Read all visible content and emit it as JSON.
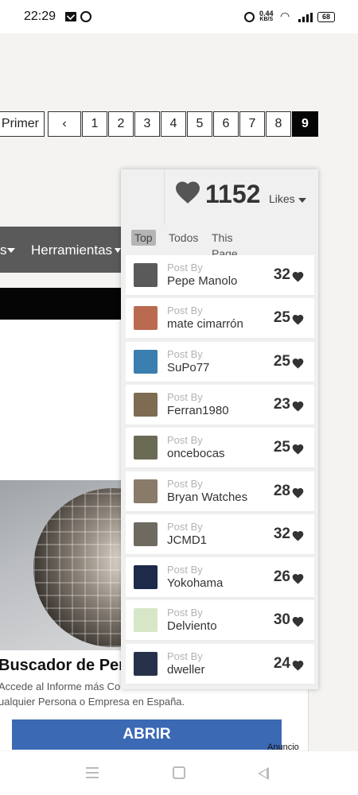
{
  "status_bar": {
    "time": "22:29",
    "net_speed_value": "0.44",
    "net_speed_unit": "KB/S",
    "battery": "68"
  },
  "pagination": {
    "first_label": "Primer",
    "prev_icon": "chevron-left-icon",
    "pages": [
      "1",
      "2",
      "3",
      "4",
      "5",
      "6",
      "7",
      "8",
      "9"
    ],
    "current_page": "9"
  },
  "likes": {
    "count": "1152",
    "label": "Likes",
    "tabs": [
      {
        "label": "Top",
        "active": true
      },
      {
        "label": "Todos",
        "active": false
      },
      {
        "label": "This Page",
        "active": false
      }
    ],
    "post_by_label": "Post By",
    "rows": [
      {
        "user": "Pepe Manolo",
        "count": "32",
        "avatar_color": "#5a5a5a"
      },
      {
        "user": "mate cimarrón",
        "count": "25",
        "avatar_color": "#b96a4f"
      },
      {
        "user": "SuPo77",
        "count": "25",
        "avatar_color": "#3a7fb0"
      },
      {
        "user": "Ferran1980",
        "count": "23",
        "avatar_color": "#7d6b52"
      },
      {
        "user": "oncebocas",
        "count": "25",
        "avatar_color": "#6b6a55"
      },
      {
        "user": "Bryan Watches",
        "count": "28",
        "avatar_color": "#8a7a6a"
      },
      {
        "user": "JCMD1",
        "count": "32",
        "avatar_color": "#6f6a60"
      },
      {
        "user": "Yokohama",
        "count": "26",
        "avatar_color": "#1d2a4a"
      },
      {
        "user": "Delviento",
        "count": "30",
        "avatar_color": "#d8e6c8"
      },
      {
        "user": "dweller",
        "count": "24",
        "avatar_color": "#27324a"
      }
    ],
    "accent_color": "#333333"
  },
  "nav_menu": {
    "partial_item": "s",
    "tools_label": "Herramientas"
  },
  "ad": {
    "title": "Buscador de Pers",
    "desc_line1": "Accede al Informe más Co",
    "desc_line2": "ualquier Persona o Empresa en España.",
    "button": "ABRIR",
    "badge": "Anuncio",
    "button_color": "#3b69b4"
  }
}
